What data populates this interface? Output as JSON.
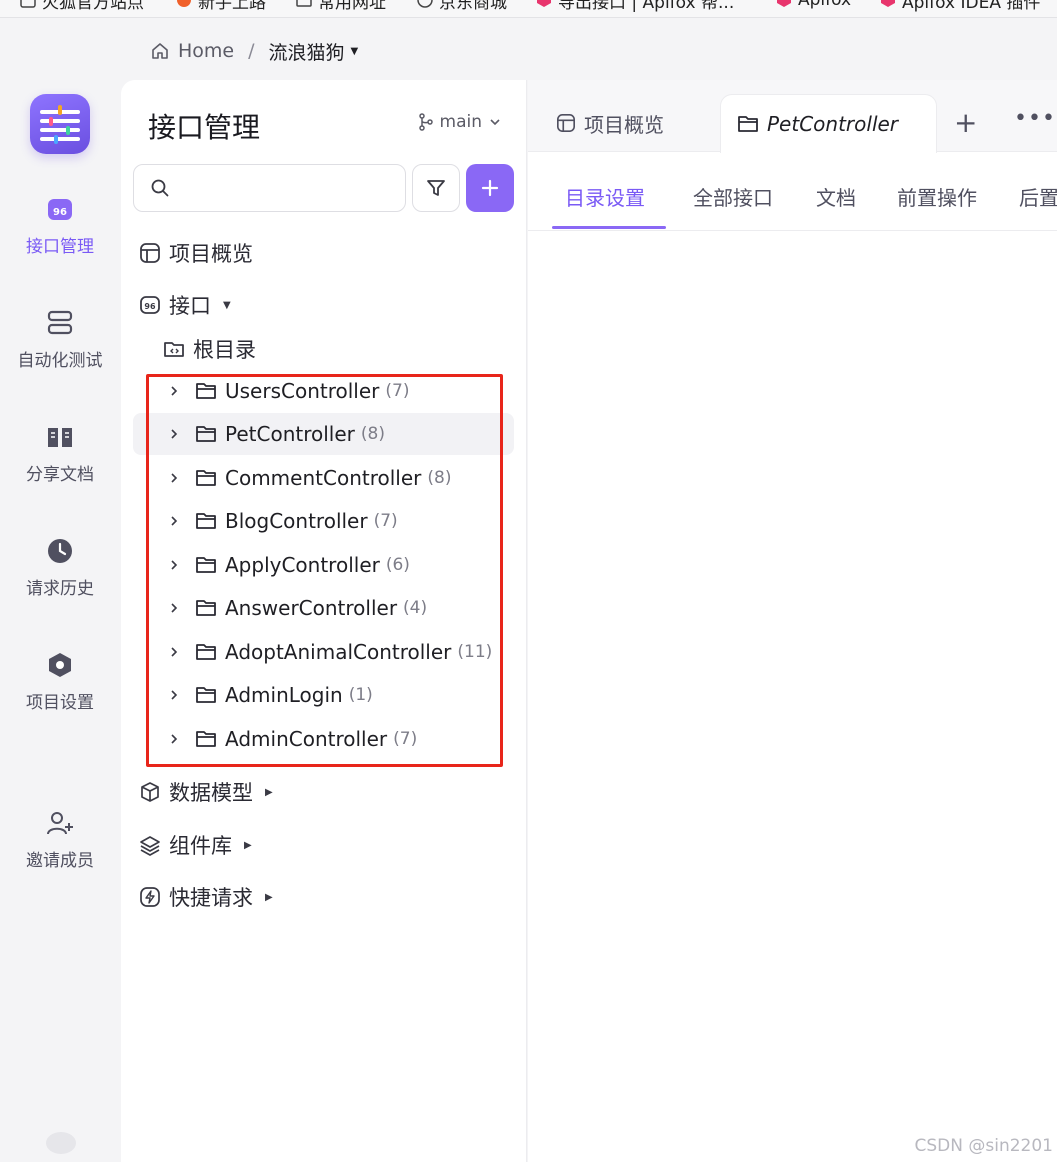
{
  "bookmarks": [
    {
      "label": "火狐官方站点",
      "icon": "firefox-icon"
    },
    {
      "label": "新手上路",
      "icon": "firefox-icon"
    },
    {
      "label": "常用网址",
      "icon": "folder-icon"
    },
    {
      "label": "京东商城",
      "icon": "globe-icon"
    },
    {
      "label": "导出接口 | Apifox 帮...",
      "icon": "apifox-icon"
    },
    {
      "label": "Apifox",
      "icon": "apifox-icon"
    },
    {
      "label": "Apifox IDEA 插件",
      "icon": "apifox-icon"
    }
  ],
  "breadcrumb": {
    "home": "Home",
    "separator": "/",
    "project": "流浪猫狗"
  },
  "rail": {
    "items": [
      {
        "label": "接口管理",
        "icon": "api-icon",
        "active": true
      },
      {
        "label": "自动化测试",
        "icon": "automation-icon",
        "active": false
      },
      {
        "label": "分享文档",
        "icon": "book-icon",
        "active": false
      },
      {
        "label": "请求历史",
        "icon": "clock-icon",
        "active": false
      },
      {
        "label": "项目设置",
        "icon": "settings-icon",
        "active": false
      },
      {
        "label": "邀请成员",
        "icon": "invite-user-icon",
        "active": false
      }
    ]
  },
  "sidebar": {
    "title": "接口管理",
    "branch": "main",
    "search_placeholder": "",
    "overview": "项目概览",
    "interfaces": "接口",
    "root": "根目录",
    "controllers": [
      {
        "name": "UsersController",
        "count": "(7)"
      },
      {
        "name": "PetController",
        "count": "(8)"
      },
      {
        "name": "CommentController",
        "count": "(8)"
      },
      {
        "name": "BlogController",
        "count": "(7)"
      },
      {
        "name": "ApplyController",
        "count": "(6)"
      },
      {
        "name": "AnswerController",
        "count": "(4)"
      },
      {
        "name": "AdoptAnimalController",
        "count": "(11)"
      },
      {
        "name": "AdminLogin",
        "count": "(1)"
      },
      {
        "name": "AdminController",
        "count": "(7)"
      }
    ],
    "data_models": "数据模型",
    "components": "组件库",
    "quick_requests": "快捷请求"
  },
  "main": {
    "tabs": [
      {
        "label": "项目概览",
        "icon": "overview-icon",
        "active": false
      },
      {
        "label": "PetController",
        "icon": "folder-icon",
        "active": true
      }
    ],
    "subtabs": [
      "目录设置",
      "全部接口",
      "文档",
      "前置操作",
      "后置"
    ],
    "active_subtab": "目录设置"
  },
  "watermark": "CSDN @sin2201",
  "colors": {
    "accent": "#8a68f5",
    "highlight_box": "#e8251a"
  }
}
